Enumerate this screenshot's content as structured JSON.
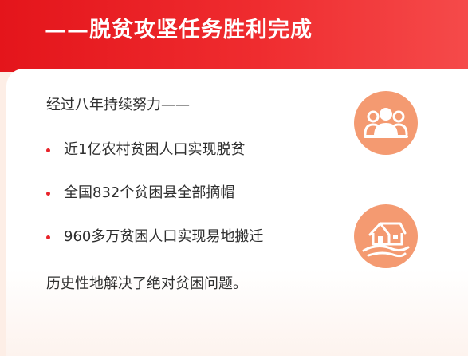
{
  "header": {
    "title": "——脱贫攻坚任务胜利完成"
  },
  "content": {
    "intro": "经过八年持续努力——",
    "bullets": [
      "近1亿农村贫困人口实现脱贫",
      "全国832个贫困县全部摘帽",
      "960多万贫困人口实现易地搬迁"
    ],
    "conclusion": "历史性地解决了绝对贫困问题。"
  },
  "icons": {
    "people": "people-group-icon",
    "house": "house-relocation-icon"
  },
  "colors": {
    "header_red": "#e4151b",
    "bullet_red": "#e8232a",
    "icon_orange": "#f49a71",
    "background": "#fdeee6",
    "text": "#2f2f2f"
  }
}
